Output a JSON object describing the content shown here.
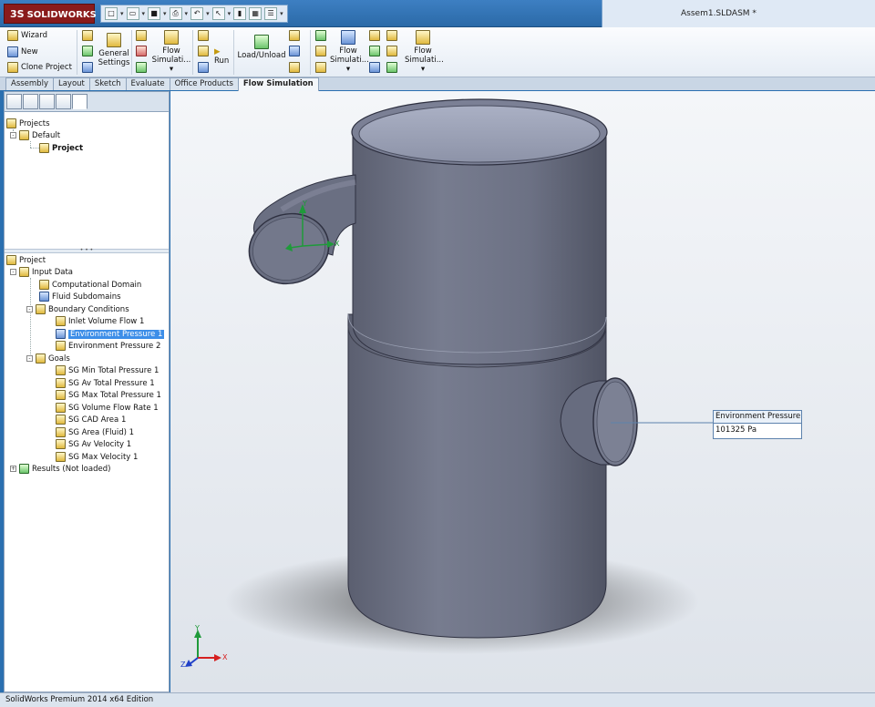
{
  "app": {
    "logo_text": "SOLIDWORKS",
    "logo_mark": "3S",
    "document_title": "Assem1.SLDASM *"
  },
  "ribbon": {
    "wizard": "Wizard",
    "new": "New",
    "clone_project": "Clone Project",
    "general_settings_line1": "General",
    "general_settings_line2": "Settings",
    "flow_simulation_1_line1": "Flow",
    "flow_simulation_1_line2": "Simulati...",
    "run": "Run",
    "load_unload": "Load/Unload",
    "flow_simulation_2_line1": "Flow",
    "flow_simulation_2_line2": "Simulati...",
    "flow_simulation_3_line1": "Flow",
    "flow_simulation_3_line2": "Simulati..."
  },
  "tabs": [
    {
      "label": "Assembly"
    },
    {
      "label": "Layout"
    },
    {
      "label": "Sketch"
    },
    {
      "label": "Evaluate"
    },
    {
      "label": "Office Products"
    },
    {
      "label": "Flow Simulation"
    }
  ],
  "projects_tree": {
    "root": "Projects",
    "default": "Default",
    "project": "Project"
  },
  "analysis_tree": {
    "project": "Project",
    "input_data": "Input Data",
    "computational_domain": "Computational Domain",
    "fluid_subdomains": "Fluid Subdomains",
    "boundary_conditions": "Boundary Conditions",
    "inlet_volume_flow": "Inlet Volume Flow 1",
    "env_pressure_1": "Environment Pressure 1",
    "env_pressure_2": "Environment Pressure 2",
    "goals": "Goals",
    "goal_items": [
      "SG Min Total Pressure 1",
      "SG Av Total Pressure 1",
      "SG Max Total Pressure 1",
      "SG Volume Flow Rate 1",
      "SG CAD Area 1",
      "SG Area (Fluid) 1",
      "SG Av Velocity 1",
      "SG Max Velocity 1"
    ],
    "results": "Results (Not loaded)"
  },
  "viewport": {
    "callout_title": "Environment Pressure",
    "callout_value": "101325 Pa",
    "axis_x": "X",
    "axis_y": "Y",
    "axis_z": "Z",
    "colors": {
      "body": "#6f7487",
      "body_light": "#8a8fa2",
      "body_dark": "#575b6b",
      "axis_x": "#d62020",
      "axis_y": "#1f9a3a",
      "axis_z": "#2040c8"
    }
  },
  "statusbar": {
    "text": "SolidWorks Premium 2014 x64 Edition"
  }
}
